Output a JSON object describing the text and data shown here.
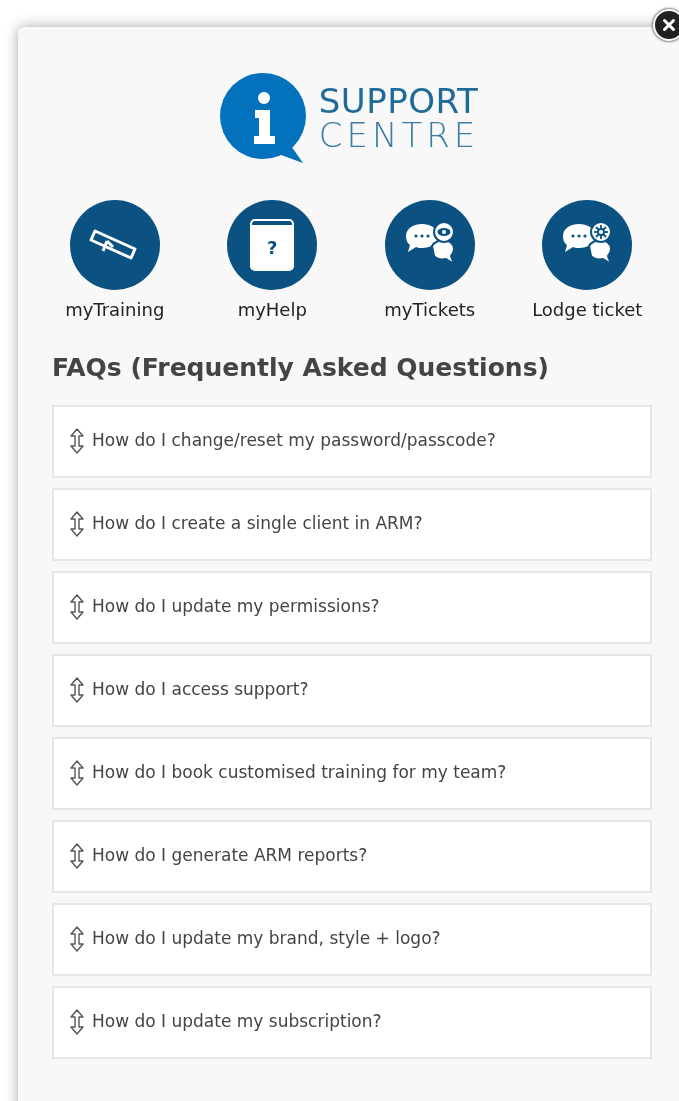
{
  "logo": {
    "line_1": "SUPPORT",
    "line_2": "CENTRE"
  },
  "shortcuts": [
    {
      "kind": "training",
      "label": "myTraining"
    },
    {
      "kind": "help",
      "label": "myHelp",
      "glyph": "?"
    },
    {
      "kind": "tickets",
      "label": "myTickets"
    },
    {
      "kind": "lodge",
      "label": "Lodge ticket"
    }
  ],
  "faq": {
    "heading": "FAQs (Frequently Asked Questions)",
    "items": [
      {
        "question": "How do I change/reset my password/passcode?",
        "expanded": false
      },
      {
        "question": "How do I create a single client in ARM?",
        "expanded": false
      },
      {
        "question": "How do I update my permissions?",
        "expanded": false
      },
      {
        "question": "How do I access support?",
        "expanded": false
      },
      {
        "question": "How do I book customised training for my team?",
        "expanded": false
      },
      {
        "question": "How do I generate ARM reports?",
        "expanded": false
      },
      {
        "question": "How do I update my brand, style + logo?",
        "expanded": false
      },
      {
        "question": "How do I update my subscription?",
        "expanded": false
      }
    ]
  }
}
